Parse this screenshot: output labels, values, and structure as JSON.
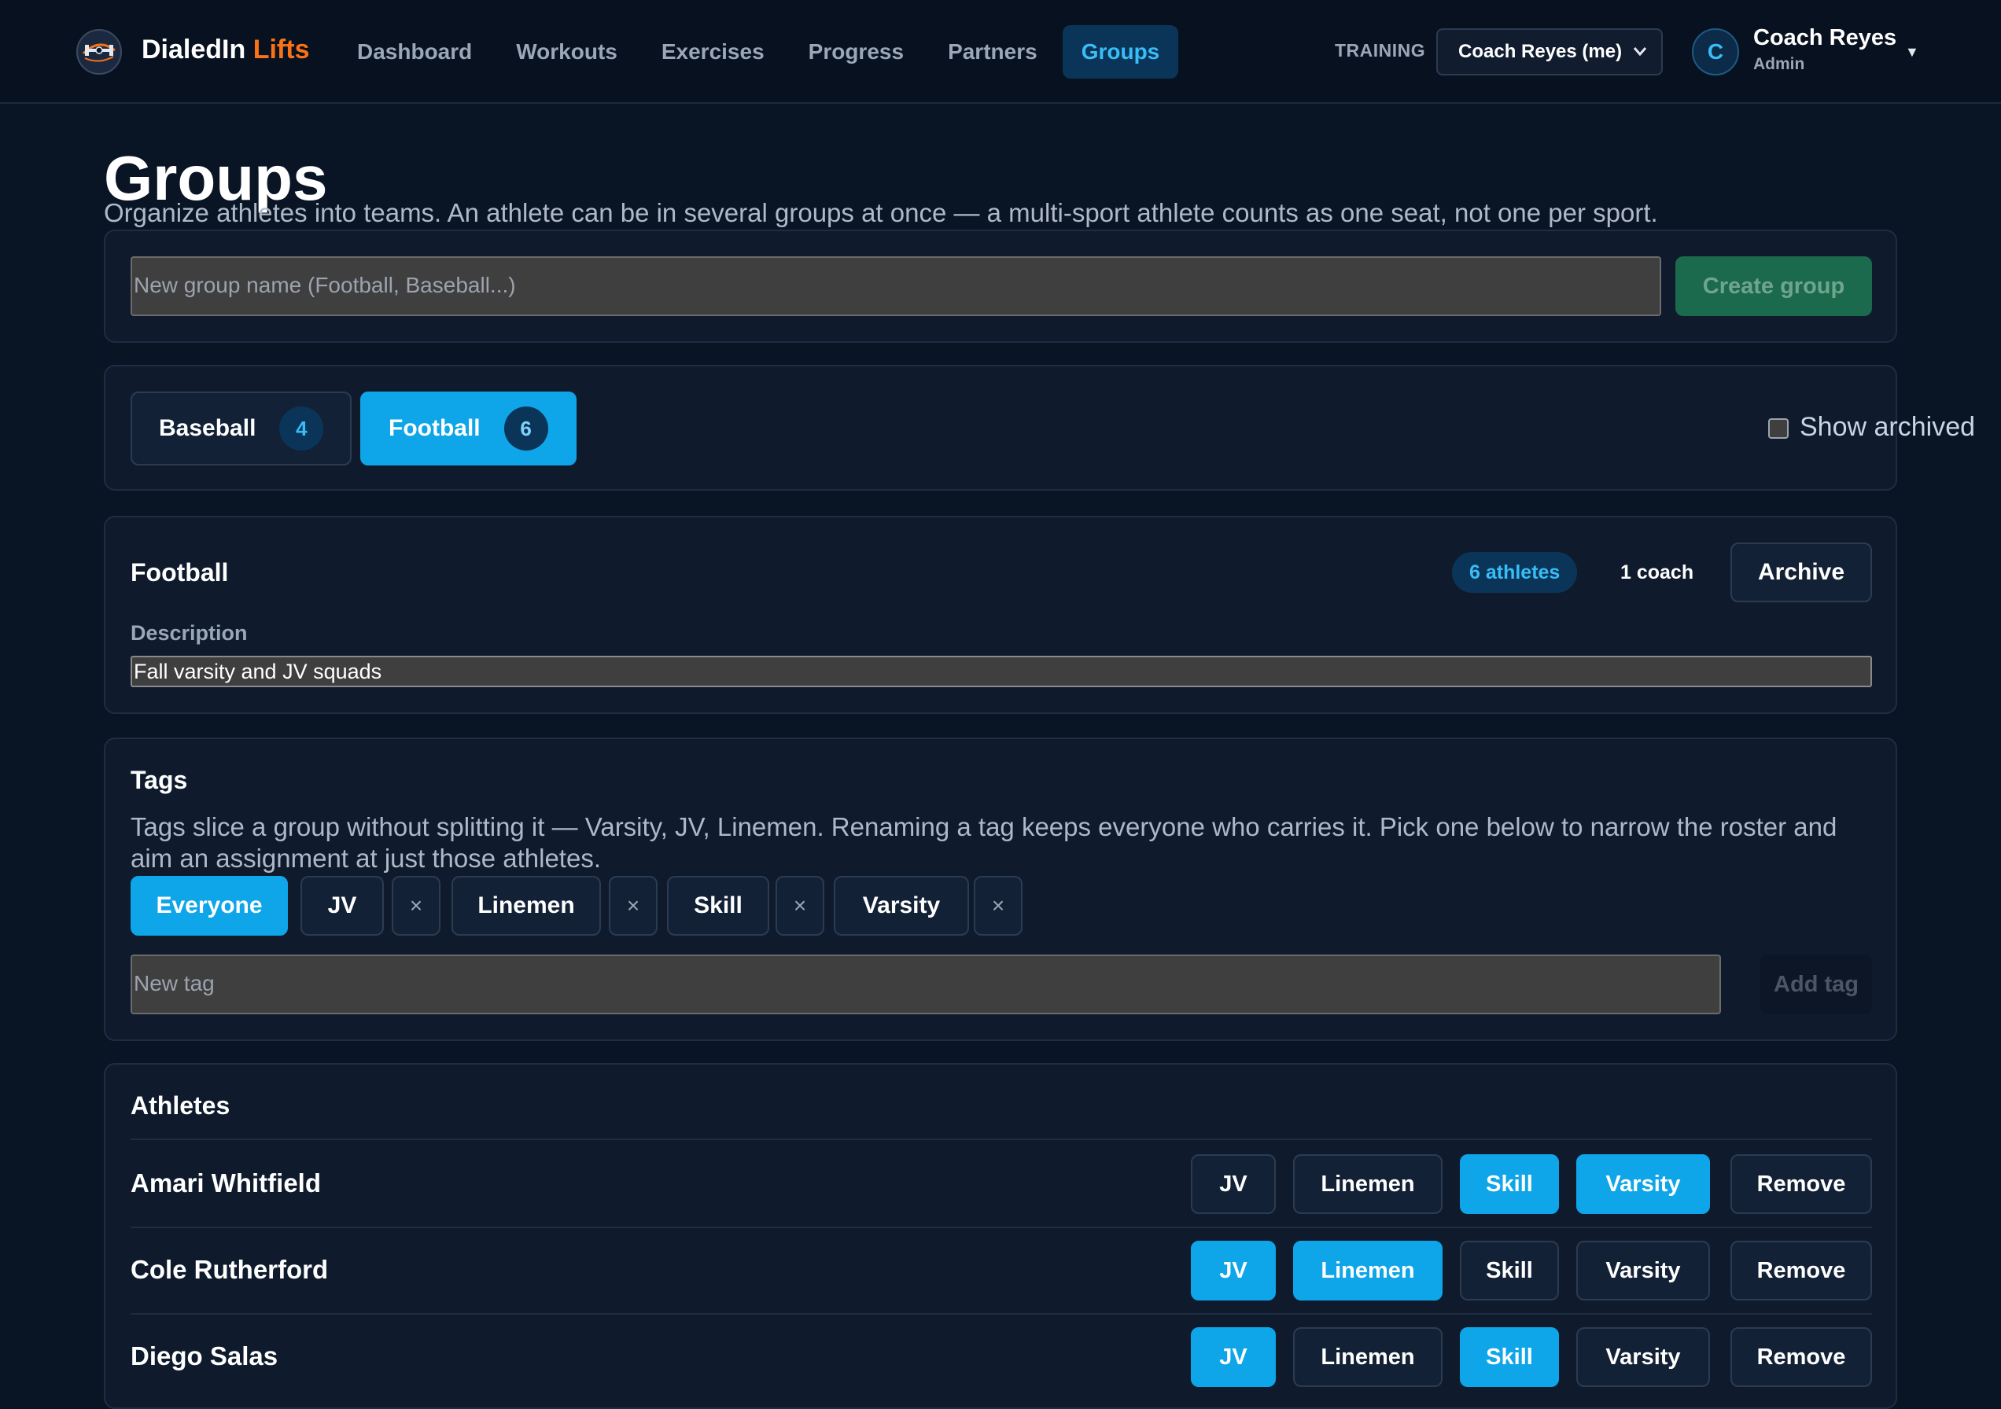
{
  "app": {
    "brand_main": "DialedIn",
    "brand_accent": "Lifts",
    "logo_icon": "dumbbell-globe-icon",
    "accent_color": "#0ea5e9",
    "brand_color": "#f97316"
  },
  "nav": {
    "items": [
      {
        "label": "Dashboard",
        "active": false
      },
      {
        "label": "Workouts",
        "active": false
      },
      {
        "label": "Exercises",
        "active": false
      },
      {
        "label": "Progress",
        "active": false
      },
      {
        "label": "Partners",
        "active": false
      },
      {
        "label": "Groups",
        "active": true
      }
    ]
  },
  "header": {
    "training_label": "TRAINING",
    "training_select_value": "Coach Reyes (me)",
    "user_initial": "C",
    "user_name": "Coach Reyes",
    "user_role": "Admin"
  },
  "page": {
    "title": "Groups",
    "subtitle": "Organize athletes into teams. An athlete can be in several groups at once — a multi-sport athlete counts as one seat, not one per sport."
  },
  "create": {
    "placeholder": "New group name (Football, Baseball...)",
    "button_label": "Create group"
  },
  "group_tabs": {
    "tabs": [
      {
        "label": "Baseball",
        "count": "4",
        "active": false
      },
      {
        "label": "Football",
        "count": "6",
        "active": true
      }
    ],
    "show_archived_label": "Show archived",
    "show_archived_checked": false
  },
  "group_detail": {
    "name": "Football",
    "athletes_pill": "6 athletes",
    "coach_count": "1 coach",
    "archive_label": "Archive",
    "description_label": "Description",
    "description_value": "Fall varsity and JV squads"
  },
  "tags": {
    "title": "Tags",
    "help": "Tags slice a group without splitting it — Varsity, JV, Linemen. Renaming a tag keeps everyone who carries it. Pick one below to narrow the roster and aim an assignment at just those athletes.",
    "everyone_label": "Everyone",
    "items": [
      "JV",
      "Linemen",
      "Skill",
      "Varsity"
    ],
    "remove_glyph": "×",
    "new_tag_placeholder": "New tag",
    "add_tag_label": "Add tag"
  },
  "athletes": {
    "title": "Athletes",
    "tag_labels": [
      "JV",
      "Linemen",
      "Skill",
      "Varsity"
    ],
    "remove_label": "Remove",
    "rows": [
      {
        "name": "Amari Whitfield",
        "tags_on": [
          false,
          false,
          true,
          true
        ]
      },
      {
        "name": "Cole Rutherford",
        "tags_on": [
          true,
          true,
          false,
          false
        ]
      },
      {
        "name": "Diego Salas",
        "tags_on": [
          true,
          false,
          true,
          false
        ]
      }
    ]
  }
}
